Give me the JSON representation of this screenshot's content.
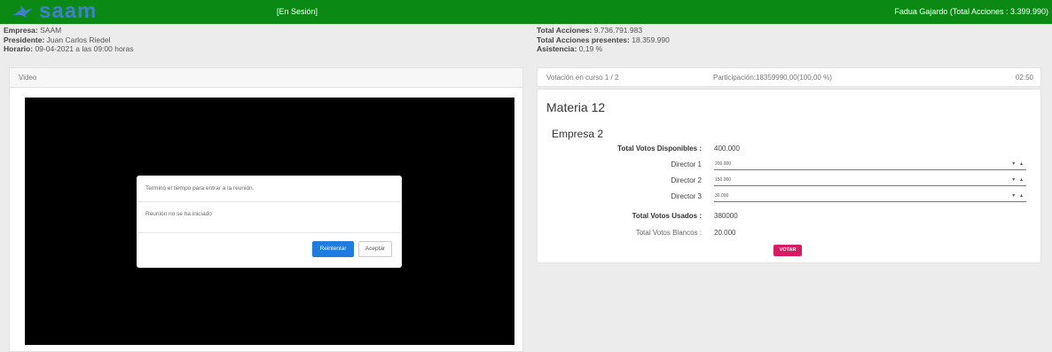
{
  "header": {
    "logo_text": "saam",
    "session_label": "[En Sesión]",
    "user_label": "Fadua Gajardo (Total Acciones : 3.399.990)",
    "colors": {
      "bar": "#0a8a15",
      "logo": "#3f7fd0"
    }
  },
  "meeting": {
    "empresa_label": "Empresa:",
    "empresa_value": "SAAM",
    "presidente_label": "Presidente:",
    "presidente_value": "Juan Carlos Riedel",
    "horario_label": "Horario:",
    "horario_value": "09-04-2021 a las 09:00 horas",
    "total_acciones_label": "Total Acciones:",
    "total_acciones_value": "9.736.791.983",
    "acciones_presentes_label": "Total Acciones presentes:",
    "acciones_presentes_value": "18.359.990",
    "asistencia_label": "Asistencia:",
    "asistencia_value": "0,19 %"
  },
  "video_panel": {
    "title": "Video",
    "modal": {
      "message": "Terminó el tiempo para entrar a la reunión.",
      "body": "Reunión no se ha iniciado",
      "retry_label": "Reintentar",
      "accept_label": "Aceptar",
      "retry_color": "#1e7be0"
    }
  },
  "vote_panel": {
    "status": "Votación en curso 1 / 2",
    "participation": "Participación:18359990,00(100,00 %)",
    "timer": "02:50",
    "materia": "Materia 12",
    "empresa": "Empresa 2",
    "available_label": "Total Votos Disponibles :",
    "available_value": "400.000",
    "directors": [
      {
        "label": "Director 1",
        "value": "200.000"
      },
      {
        "label": "Director 2",
        "value": "150.000"
      },
      {
        "label": "Director 3",
        "value": "30.000"
      }
    ],
    "used_label": "Total Votos Usados :",
    "used_value": "380000",
    "blank_label": "Total Votos Blancos :",
    "blank_value": "20.000",
    "vote_button": "VOTAR",
    "spinner_icons": "▾ ▴",
    "vote_color": "#d81b60",
    "field_underline_color": "#2ea44f"
  }
}
